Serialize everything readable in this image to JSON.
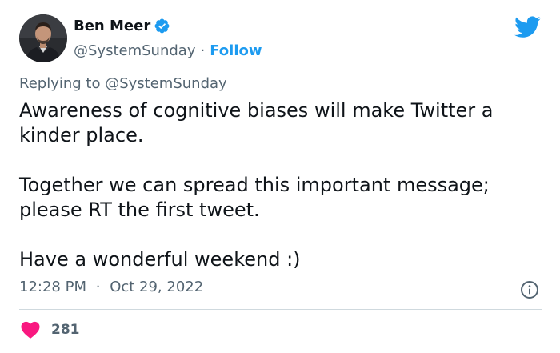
{
  "author": {
    "display_name": "Ben Meer",
    "handle": "@SystemSunday",
    "separator": "·",
    "follow_label": "Follow"
  },
  "reply": {
    "text": "Replying to @SystemSunday"
  },
  "tweet": {
    "text": "Awareness of cognitive biases will make Twitter a\nkinder place.\n\nTogether we can spread this important message;\nplease RT the first tweet.\n\nHave a wonderful weekend :)",
    "time": "12:28 PM",
    "separator": "·",
    "date": "Oct 29, 2022"
  },
  "stats": {
    "likes": "281"
  },
  "colors": {
    "accent": "#1d9bf0",
    "like": "#f91880",
    "text_primary": "#0f1419",
    "text_secondary": "#536471"
  },
  "icons": {
    "verified": "verified-badge-icon",
    "brand": "twitter-bird-icon",
    "info": "info-icon",
    "like": "heart-icon"
  }
}
